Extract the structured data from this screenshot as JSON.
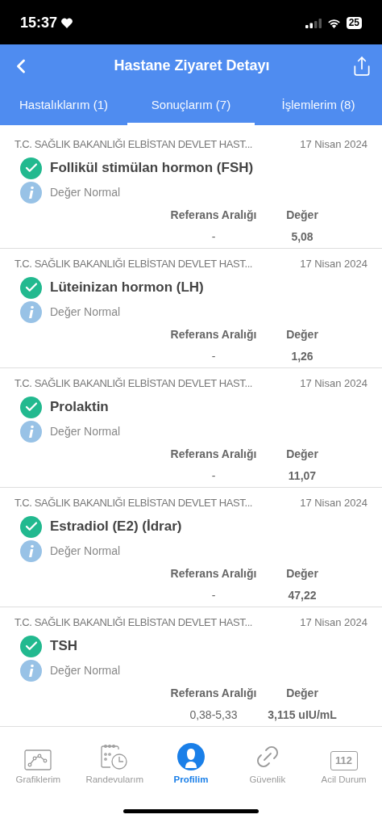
{
  "status_bar": {
    "time": "15:37",
    "battery": "25"
  },
  "header": {
    "title": "Hastane Ziyaret Detayı"
  },
  "tabs": [
    {
      "label": "Hastalıklarım (1)",
      "selected": false
    },
    {
      "label": "Sonuçlarım (7)",
      "selected": true
    },
    {
      "label": "İşlemlerim (8)",
      "selected": false
    }
  ],
  "results": [
    {
      "hospital": "T.C. SAĞLIK BAKANLIĞI ELBİSTAN DEVLET HAST...",
      "date": "17 Nisan 2024",
      "test": "Follikül stimülan hormon (FSH)",
      "status": "Değer Normal",
      "reference_label": "Referans Aralığı",
      "value_label": "Değer",
      "reference": "-",
      "value": "5,08"
    },
    {
      "hospital": "T.C. SAĞLIK BAKANLIĞI ELBİSTAN DEVLET HAST...",
      "date": "17 Nisan 2024",
      "test": "Lüteinizan hormon (LH)",
      "status": "Değer Normal",
      "reference_label": "Referans Aralığı",
      "value_label": "Değer",
      "reference": "-",
      "value": "1,26"
    },
    {
      "hospital": "T.C. SAĞLIK BAKANLIĞI ELBİSTAN DEVLET HAST...",
      "date": "17 Nisan 2024",
      "test": "Prolaktin",
      "status": "Değer Normal",
      "reference_label": "Referans Aralığı",
      "value_label": "Değer",
      "reference": "-",
      "value": "11,07"
    },
    {
      "hospital": "T.C. SAĞLIK BAKANLIĞI ELBİSTAN DEVLET HAST...",
      "date": "17 Nisan 2024",
      "test": "Estradiol (E2) (İdrar)",
      "status": "Değer Normal",
      "reference_label": "Referans Aralığı",
      "value_label": "Değer",
      "reference": "-",
      "value": "47,22"
    },
    {
      "hospital": "T.C. SAĞLIK BAKANLIĞI ELBİSTAN DEVLET HAST...",
      "date": "17 Nisan 2024",
      "test": "TSH",
      "status": "Değer Normal",
      "reference_label": "Referans Aralığı",
      "value_label": "Değer",
      "reference": "0,38-5,33",
      "value": "3,115 uIU/mL"
    }
  ],
  "bottom_nav": [
    {
      "kind": "chart",
      "label": "Grafiklerim",
      "selected": false
    },
    {
      "kind": "calendar",
      "label": "Randevularım",
      "selected": false
    },
    {
      "kind": "profile",
      "label": "Profilim",
      "selected": true
    },
    {
      "kind": "link",
      "label": "Güvenlik",
      "selected": false
    },
    {
      "kind": "emergency",
      "label": "Acil Durum",
      "selected": false,
      "icon_text": "112"
    }
  ]
}
